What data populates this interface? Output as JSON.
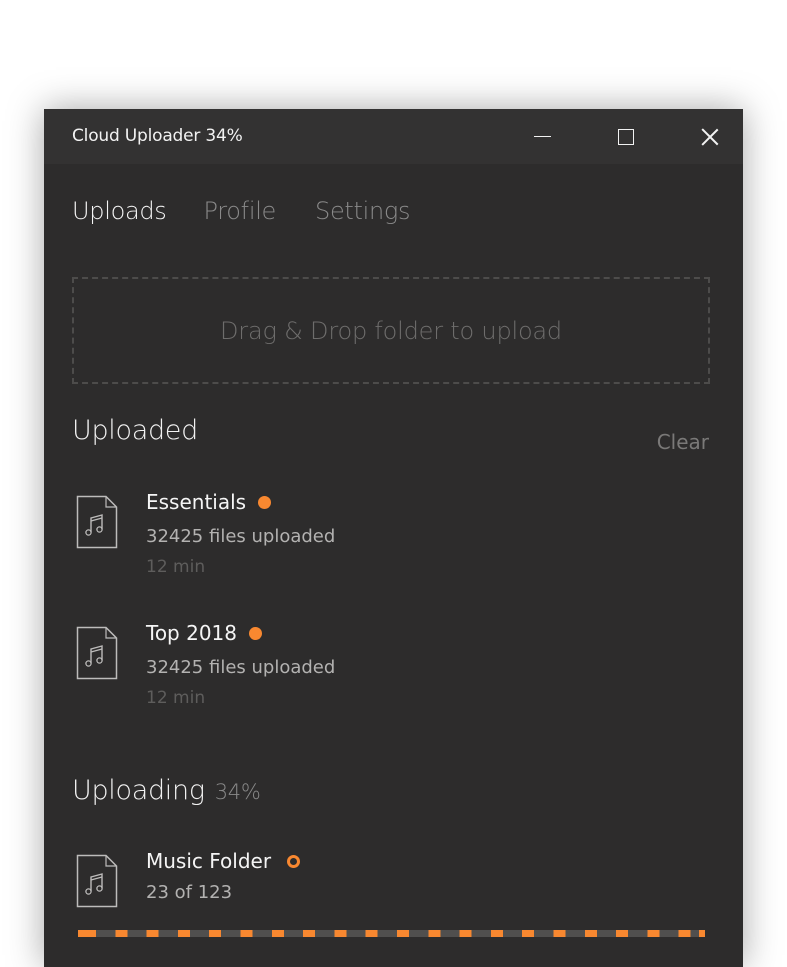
{
  "window": {
    "title": "Cloud Uploader  34%",
    "controls": {
      "minimize": "minimize",
      "maximize": "maximize",
      "close": "close"
    }
  },
  "tabs": [
    {
      "label": "Uploads",
      "active": true
    },
    {
      "label": "Profile",
      "active": false
    },
    {
      "label": "Settings",
      "active": false
    }
  ],
  "dropzone": {
    "text": "Drag & Drop folder to upload"
  },
  "uploaded": {
    "title": "Uploaded",
    "clear_label": "Clear",
    "items": [
      {
        "name": "Essentials",
        "subtitle": "32425 files uploaded",
        "time": "12 min",
        "icon": "music-file-icon",
        "status": "complete"
      },
      {
        "name": "Top 2018",
        "subtitle": "32425 files uploaded",
        "time": "12 min",
        "icon": "music-file-icon",
        "status": "complete"
      }
    ]
  },
  "uploading": {
    "title": "Uploading",
    "percent": "34%",
    "items": [
      {
        "name": "Music Folder",
        "subtitle": "23 of 123",
        "icon": "music-file-icon",
        "status": "in-progress"
      }
    ]
  },
  "colors": {
    "accent": "#f88830",
    "background": "#2d2c2c",
    "titlebar": "#333232"
  }
}
